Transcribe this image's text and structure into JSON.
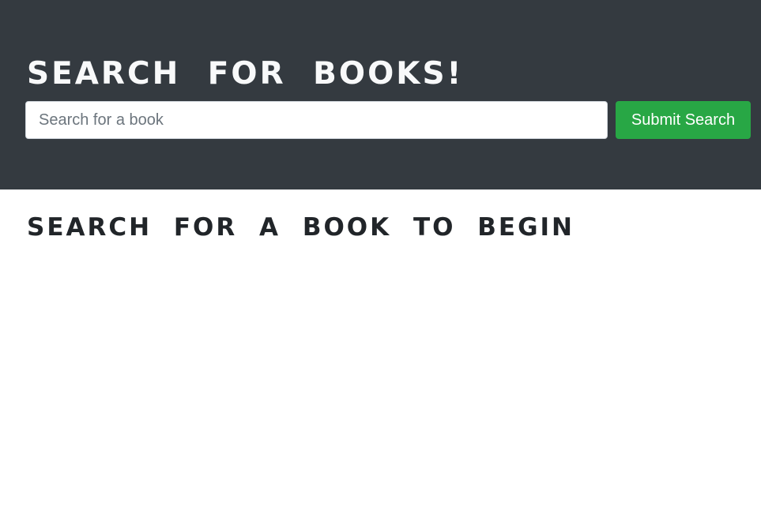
{
  "hero": {
    "title": "SEARCH FOR BOOKS!",
    "search": {
      "value": "",
      "placeholder": "Search for a book"
    },
    "submit_label": "Submit Search"
  },
  "main": {
    "heading": "SEARCH FOR A BOOK TO BEGIN"
  },
  "colors": {
    "hero_bg": "#343a40",
    "hero_text": "#f8f9fa",
    "button_bg": "#28a745",
    "heading_text": "#212529"
  }
}
